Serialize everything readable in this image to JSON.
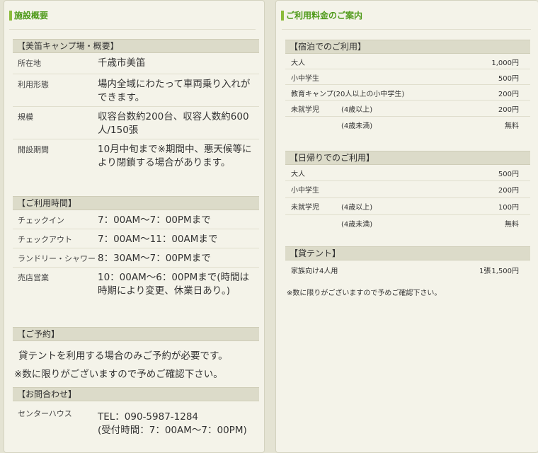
{
  "facility": {
    "title": "施設概要",
    "overview": {
      "heading": "【美笛キャンプ場・概要】",
      "rows": [
        {
          "label": "所在地",
          "value": "千歳市美笛"
        },
        {
          "label": "利用形態",
          "value": "場内全域にわたって車両乗り入れができます。"
        },
        {
          "label": "規模",
          "value": "収容台数約200台、収容人数約600人/150張"
        },
        {
          "label": "開設期間",
          "value": "10月中旬まで※期間中、悪天候等により閉鎖する場合があります。"
        }
      ]
    },
    "hours": {
      "heading": "【ご利用時間】",
      "rows": [
        {
          "label": "チェックイン",
          "value": "7：00AM〜7：00PMまで"
        },
        {
          "label": "チェックアウト",
          "value": "7：00AM〜11：00AMまで"
        },
        {
          "label": "ランドリー・シャワー",
          "value": "8：30AM〜7：00PMまで"
        },
        {
          "label": "売店営業",
          "value": "10：00AM〜6：00PMまで(時間は時期により変更、休業日あり。)"
        }
      ]
    },
    "reservation": {
      "heading": "【ご予約】",
      "text": "貸テントを利用する場合のみご予約が必要です。",
      "note": "※数に限りがございますので予めご確認下さい。"
    },
    "contact": {
      "heading": "【お問合わせ】",
      "label": "センターハウス",
      "tel": "TEL：090-5987-1284",
      "hours": "(受付時間：7：00AM〜7：00PM)"
    }
  },
  "fees": {
    "title": "ご利用料金のご案内",
    "overnight": {
      "heading": "【宿泊でのご利用】",
      "rows": [
        {
          "label": "大人",
          "sub": "",
          "price": "1,000円"
        },
        {
          "label": "小中学生",
          "sub": "",
          "price": "500円"
        },
        {
          "label": "教育キャンプ(20人以上の小中学生)",
          "sub": "",
          "price": "200円"
        },
        {
          "label": "未就学児",
          "sub": "(4歳以上)",
          "price": "200円"
        },
        {
          "label": "",
          "sub": "(4歳未満)",
          "price": "無料"
        }
      ]
    },
    "day": {
      "heading": "【日帰りでのご利用】",
      "rows": [
        {
          "label": "大人",
          "sub": "",
          "price": "500円"
        },
        {
          "label": "小中学生",
          "sub": "",
          "price": "200円"
        },
        {
          "label": "未就学児",
          "sub": "(4歳以上)",
          "price": "100円"
        },
        {
          "label": "",
          "sub": "(4歳未満)",
          "price": "無料"
        }
      ]
    },
    "tent": {
      "heading": "【貸テント】",
      "label": "家族向け4人用",
      "qty": "1張",
      "price": "1,500円"
    },
    "note": "※数に限りがございますので予めご確認下さい。"
  },
  "colors": {
    "background": "#e4e3d3",
    "panel": "#f4f3e9",
    "section_header": "#dcdbc9",
    "title_accent": "#4f9a1a"
  }
}
